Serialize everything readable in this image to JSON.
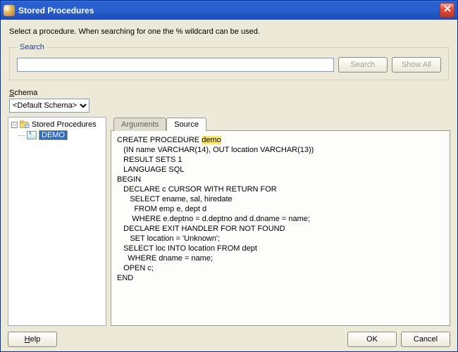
{
  "window": {
    "title": "Stored Procedures"
  },
  "intro": "Select a procedure. When searching for one the % wildcard can be used.",
  "search": {
    "legend": "Search",
    "value": "",
    "search_btn": "Search",
    "showall_btn": "Show All"
  },
  "schema": {
    "label": "Schema",
    "selected": "<Default Schema>"
  },
  "tree": {
    "root_label": "Stored Procedures",
    "items": [
      {
        "label": "DEMO",
        "selected": true
      }
    ]
  },
  "tabs": {
    "arguments": "Arguments",
    "source": "Source",
    "active": "source"
  },
  "source": {
    "lines": [
      "CREATE PROCEDURE ",
      "   (IN name VARCHAR(14), OUT location VARCHAR(13))",
      "   RESULT SETS 1",
      "   LANGUAGE SQL",
      "BEGIN",
      "   DECLARE c CURSOR WITH RETURN FOR",
      "      SELECT ename, sal, hiredate",
      "        FROM emp e, dept d",
      "       WHERE e.deptno = d.deptno and d.dname = name;",
      "   DECLARE EXIT HANDLER FOR NOT FOUND",
      "      SET location = 'Unknown';",
      "   SELECT loc INTO location FROM dept",
      "     WHERE dname = name;",
      "   OPEN c;",
      "END"
    ],
    "highlight": "demo"
  },
  "footer": {
    "help": "Help",
    "ok": "OK",
    "cancel": "Cancel"
  }
}
